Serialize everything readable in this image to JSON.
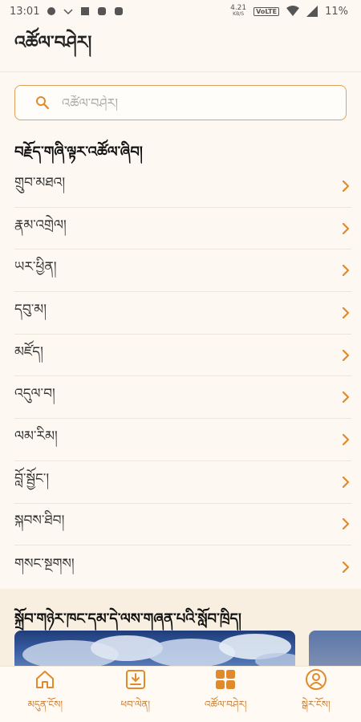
{
  "status_bar": {
    "time": "13:01",
    "speed_value": "4.21",
    "speed_unit": "KB/S",
    "volte": "VoLTE",
    "battery": "11%"
  },
  "header": {
    "title": "འཚོལ་བཤེར།"
  },
  "search": {
    "placeholder": "འཚོལ་བཤེར།"
  },
  "section": {
    "title": "བརྗོད་གཞི་ལྟར་འཚོལ་ཞིབ།"
  },
  "menu": {
    "items": [
      {
        "label": "གྲུབ་མཐའ།"
      },
      {
        "label": "རྣམ་འགྲེལ།"
      },
      {
        "label": "ཡར་ཕྱིན།"
      },
      {
        "label": "དབུ་མ།"
      },
      {
        "label": "མཛོད།"
      },
      {
        "label": "འདུལ་བ།"
      },
      {
        "label": "ལམ་རིམ།"
      },
      {
        "label": "བློ་སྦྱོང་།"
      },
      {
        "label": "སྐབས་ཐིབ།"
      },
      {
        "label": "གསང་སྔགས།"
      }
    ]
  },
  "promo": {
    "title": "སྐྲོབ་གཉེར་ཁང་དམ་དེ་ལས་གཞན་པའི་སློབ་ཁྲིད།"
  },
  "nav": {
    "items": [
      {
        "label": "མདུན་ངོས།",
        "icon": "home-icon"
      },
      {
        "label": "ཕབ་ལེན།",
        "icon": "download-icon"
      },
      {
        "label": "འཚོལ་བཤེར།",
        "icon": "grid-icon"
      },
      {
        "label": "སྒེར་ངོས།",
        "icon": "profile-icon"
      }
    ]
  },
  "colors": {
    "accent": "#e08a2c",
    "background": "#fdf8f1"
  }
}
